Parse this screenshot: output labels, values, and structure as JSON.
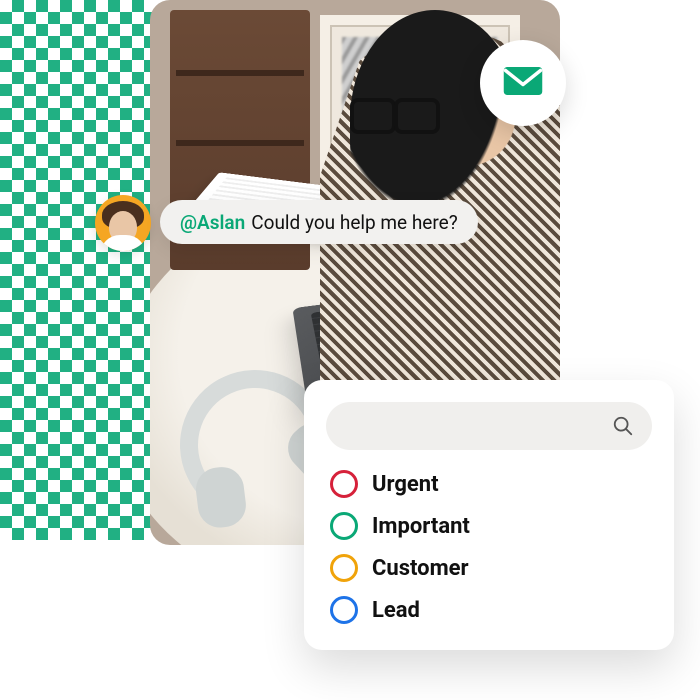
{
  "mention": {
    "handle": "@Aslan",
    "message": "Could you help me here?"
  },
  "search": {
    "placeholder": ""
  },
  "tags": [
    {
      "label": "Urgent",
      "color": "#d6213a"
    },
    {
      "label": "Important",
      "color": "#0aa876"
    },
    {
      "label": "Customer",
      "color": "#f0a30a"
    },
    {
      "label": "Lead",
      "color": "#1e73e8"
    }
  ],
  "icons": {
    "email": "email-icon",
    "search": "search-icon"
  }
}
